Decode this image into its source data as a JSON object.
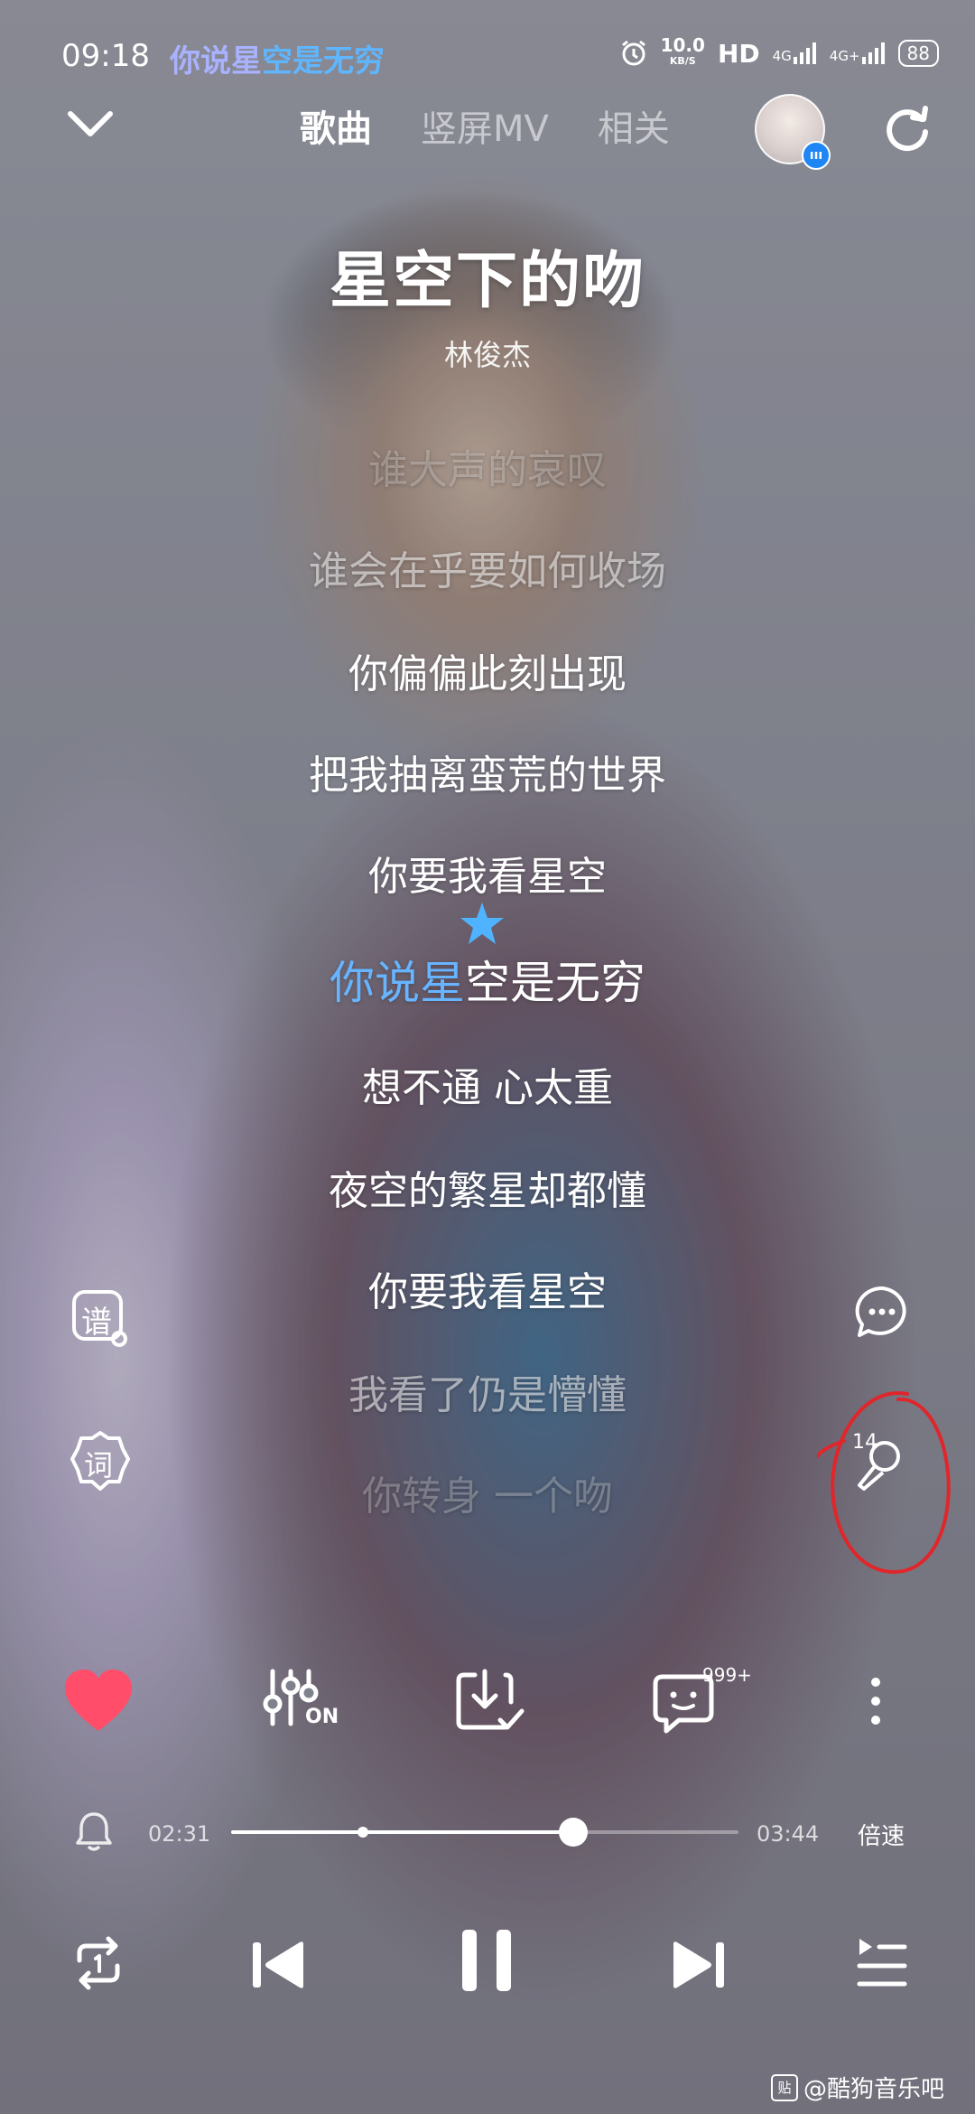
{
  "status_bar": {
    "time": "09:18",
    "lyric_sung": "你说星",
    "lyric_rest": "空是无穷",
    "net_speed_top": "10.0",
    "net_speed_unit": "KB/S",
    "hd": "HD",
    "signal1": "4G",
    "signal2": "4G+",
    "battery": "88"
  },
  "nav": {
    "tabs": [
      "歌曲",
      "竖屏MV",
      "相关"
    ],
    "active_tab": 0
  },
  "song": {
    "title": "星空下的吻",
    "artist": "林俊杰"
  },
  "lyrics": {
    "lines": [
      "谁大声的哀叹",
      "谁会在乎要如何收场",
      "你偏偏此刻出现",
      "把我抽离蛮荒的世界",
      "你要我看星空",
      "你说星空是无穷",
      "想不通 心太重",
      "夜空的繁星却都懂",
      "你要我看星空",
      "我看了仍是懵懂",
      "你转身 一个吻"
    ],
    "current_index": 5,
    "current_sung": "你说星",
    "current_rest": "空是无穷"
  },
  "side_buttons": {
    "score_label": "谱",
    "lyrics_label": "词",
    "score_count": "14"
  },
  "actions": {
    "comments_count": "999+",
    "effect_label": "ON"
  },
  "progress": {
    "elapsed": "02:31",
    "total": "03:44",
    "fraction": 0.674,
    "buffered_fraction": 0.26,
    "speed_label": "倍速"
  },
  "watermark": {
    "icon_text": "贴",
    "text": "@酷狗音乐吧"
  },
  "colors": {
    "accent": "#67b4ff",
    "like": "#ff4d6a",
    "annotation": "#e0262b"
  }
}
